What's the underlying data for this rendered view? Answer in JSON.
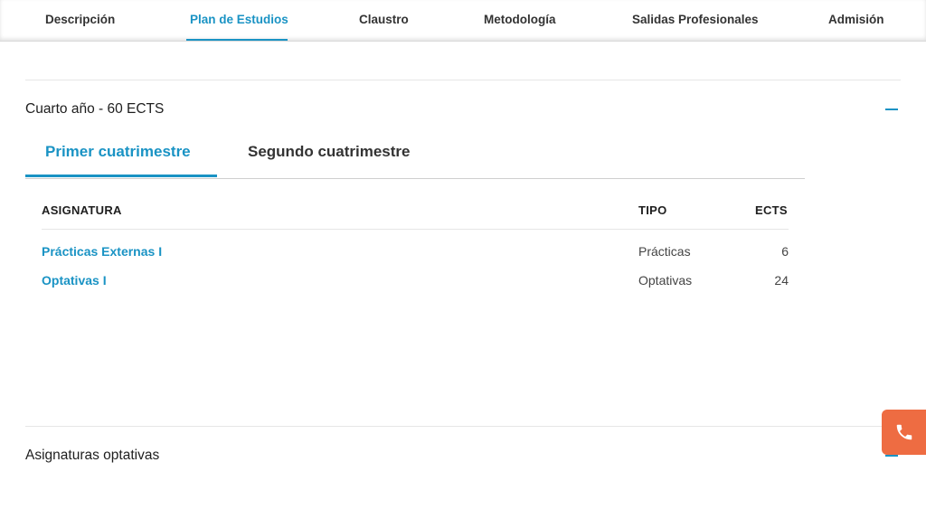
{
  "nav": {
    "items": [
      "Descripción",
      "Plan de Estudios",
      "Claustro",
      "Metodología",
      "Salidas Profesionales",
      "Admisión"
    ],
    "active_index": 1
  },
  "section": {
    "title": "Cuarto año - 60 ECTS",
    "tabs": [
      "Primer cuatrimestre",
      "Segundo cuatrimestre"
    ],
    "active_tab": 0,
    "table": {
      "headers": [
        "ASIGNATURA",
        "TIPO",
        "ECTS"
      ],
      "rows": [
        {
          "asignatura": "Prácticas Externas I",
          "tipo": "Prácticas",
          "ects": "6"
        },
        {
          "asignatura": "Optativas I",
          "tipo": "Optativas",
          "ects": "24"
        }
      ]
    }
  },
  "optional_section": {
    "title": "Asignaturas optativas"
  },
  "icons": {
    "collapse": "minus-icon",
    "phone": "phone-icon"
  },
  "colors": {
    "accent": "#1a93c4",
    "phone_button": "#ee6c42"
  }
}
